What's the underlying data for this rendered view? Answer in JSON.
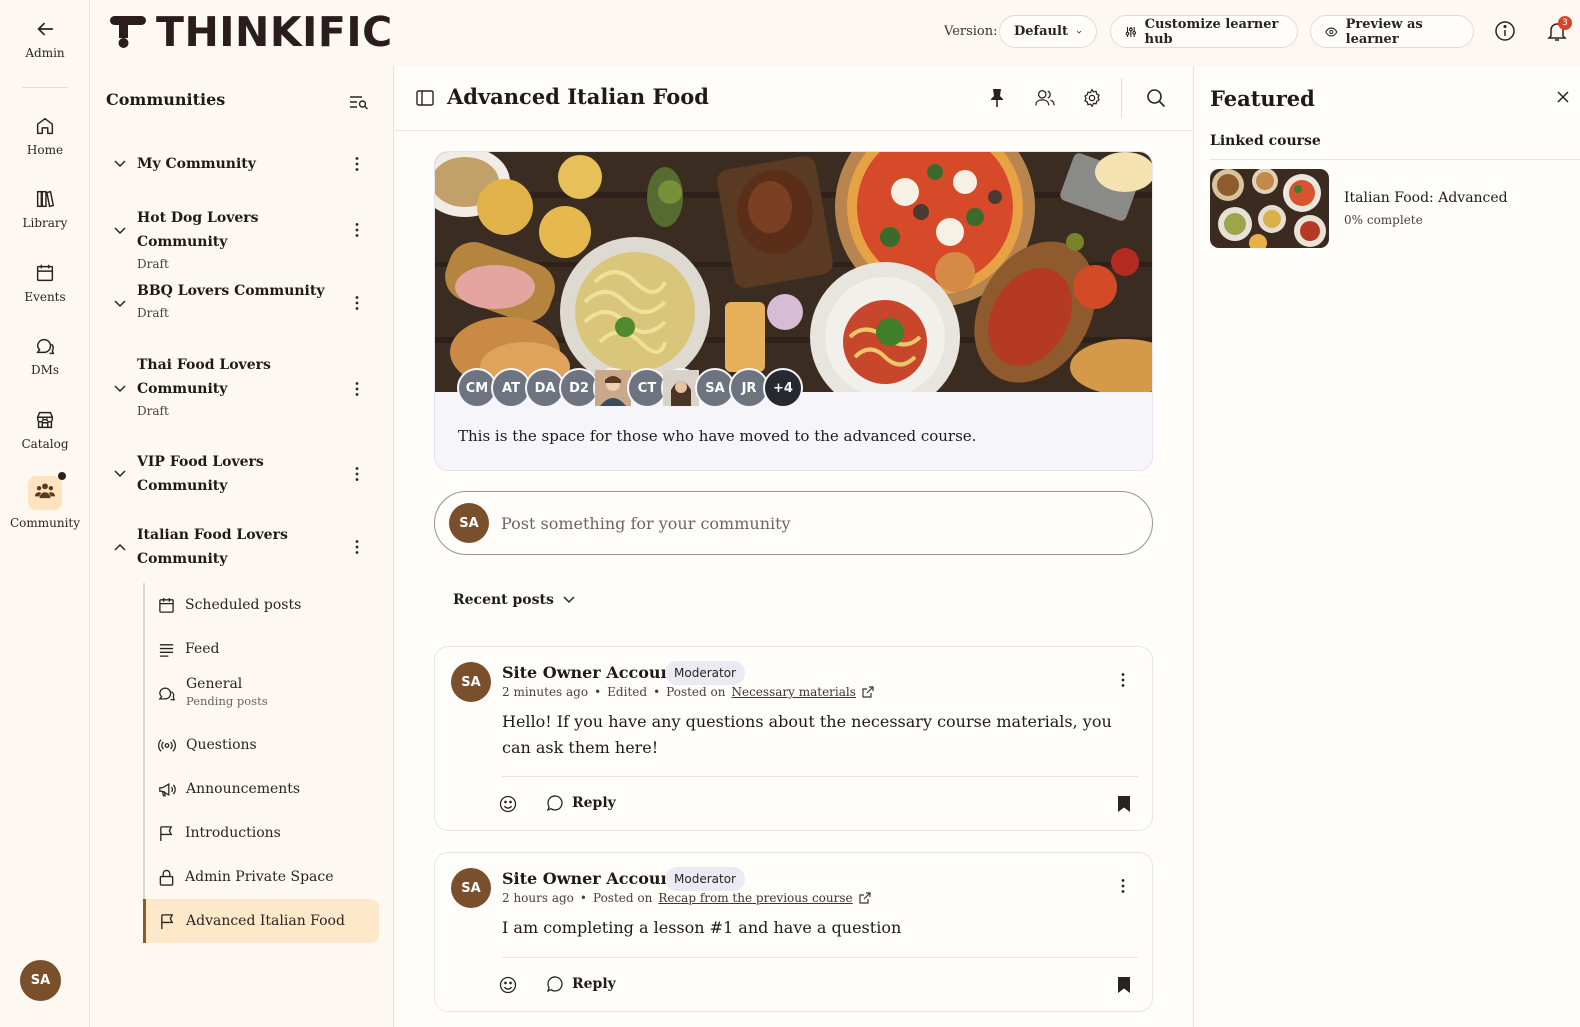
{
  "rail": {
    "admin": "Admin",
    "home": "Home",
    "library": "Library",
    "events": "Events",
    "dms": "DMs",
    "catalog": "Catalog",
    "community": "Community",
    "user_initials": "SA"
  },
  "header": {
    "logo": "THINKIFIC",
    "version_label": "Version:",
    "version_value": "Default",
    "customize": "Customize learner hub",
    "preview": "Preview as learner",
    "notification_count": "3"
  },
  "sidebar": {
    "title": "Communities",
    "communities": [
      {
        "name": "My Community",
        "status": ""
      },
      {
        "name": "Hot Dog Lovers Community",
        "status": "Draft"
      },
      {
        "name": "BBQ Lovers Community",
        "status": "Draft"
      },
      {
        "name": "Thai Food Lovers Community",
        "status": "Draft"
      },
      {
        "name": "VIP Food Lovers Community",
        "status": ""
      },
      {
        "name": "Italian Food Lovers Community",
        "status": ""
      }
    ],
    "spaces": [
      {
        "label": "Scheduled posts",
        "sub": ""
      },
      {
        "label": "Feed",
        "sub": ""
      },
      {
        "label": "General",
        "sub": "Pending posts"
      },
      {
        "label": "Questions",
        "sub": ""
      },
      {
        "label": "Announcements",
        "sub": ""
      },
      {
        "label": "Introductions",
        "sub": ""
      },
      {
        "label": "Admin Private Space",
        "sub": ""
      },
      {
        "label": "Advanced Italian Food",
        "sub": ""
      }
    ]
  },
  "main": {
    "title": "Advanced Italian Food",
    "members": [
      "CM",
      "AT",
      "DA",
      "D2",
      "",
      "CT",
      "",
      "SA",
      "JR",
      "+4"
    ],
    "description": "This is the space for those who have moved to the advanced course.",
    "composer_initials": "SA",
    "composer_placeholder": "Post something for your community",
    "sort_label": "Recent posts",
    "posts": [
      {
        "initials": "SA",
        "author": "Site Owner Account",
        "badge": "Moderator",
        "time": "2 minutes ago",
        "edited": "Edited",
        "posted_on_label": "Posted on",
        "posted_on": "Necessary materials",
        "body": "Hello! If you have any questions about the necessary course materials, you can ask them here!",
        "reply": "Reply"
      },
      {
        "initials": "SA",
        "author": "Site Owner Account",
        "badge": "Moderator",
        "time": "2 hours ago",
        "edited": "",
        "posted_on_label": "Posted on",
        "posted_on": "Recap from the previous course",
        "body": "I am completing a lesson #1 and have a question",
        "reply": "Reply"
      }
    ]
  },
  "featured": {
    "title": "Featured",
    "section": "Linked course",
    "course_name": "Italian Food: Advanced",
    "course_progress": "0% complete"
  },
  "colors": {
    "accent_brown": "#7a4f2b",
    "active_bg": "#fde9c9",
    "page_bg": "#fdf8f2"
  }
}
